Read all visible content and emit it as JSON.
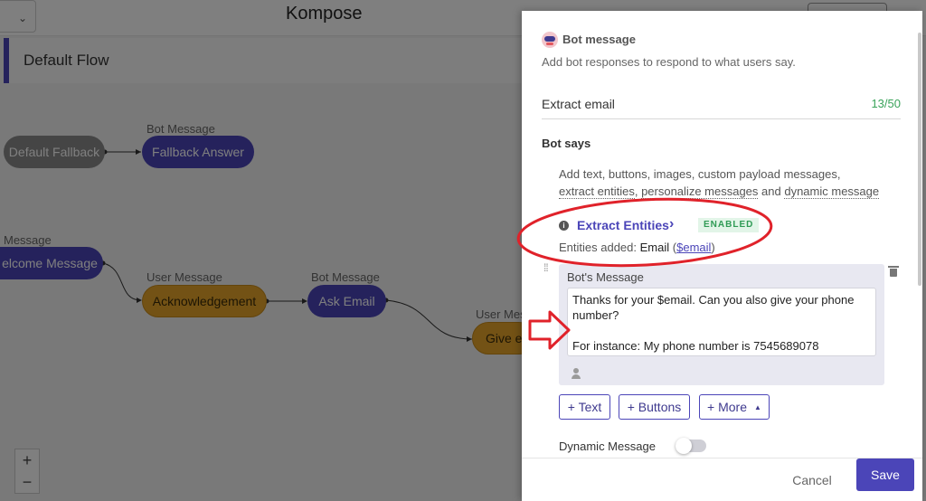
{
  "app": {
    "title": "Kompose"
  },
  "flow": {
    "title": "Default Flow"
  },
  "nodes": [
    {
      "id": "default-fallback",
      "type_label": "",
      "label": "Default Fallback",
      "kind": "grey"
    },
    {
      "id": "fallback-answer",
      "type_label": "Bot Message",
      "label": "Fallback Answer",
      "kind": "bot"
    },
    {
      "id": "welcome",
      "type_label": "Message",
      "label": "elcome Message",
      "kind": "bot"
    },
    {
      "id": "acknowledgement",
      "type_label": "User Message",
      "label": "Acknowledgement",
      "kind": "user"
    },
    {
      "id": "ask-email",
      "type_label": "Bot Message",
      "label": "Ask Email",
      "kind": "bot"
    },
    {
      "id": "give-email",
      "type_label": "User Mes",
      "label": "Give em",
      "kind": "user"
    }
  ],
  "zoom": {
    "in": "+",
    "out": "−"
  },
  "panel": {
    "title": "Bot message",
    "description": "Add bot responses to respond to what users say.",
    "name_value": "Extract email",
    "char_count": "13/50",
    "section_title": "Bot says",
    "help_line1": "Add text, buttons, images, custom payload messages,",
    "help_extract": "extract entities",
    "help_sep1": ", ",
    "help_personalize": "personalize messages",
    "help_and": " and ",
    "help_dynamic": "dynamic message",
    "extract_entities_label": "Extract Entities",
    "extract_chevron": "›",
    "enabled_badge": "ENABLED",
    "entities_prefix": "Entities added:",
    "entity_name": "Email",
    "entity_paren_open": "(",
    "entity_var": "$email",
    "entity_paren_close": ")",
    "card_title": "Bot's Message",
    "message_lines": [
      "Thanks for your $email. Can you also give your phone",
      "number?",
      "",
      "For instance: My phone number is 7545689078"
    ],
    "btn_text": "+ Text",
    "btn_buttons": "+ Buttons",
    "btn_more": "+ More",
    "dynamic_label": "Dynamic Message",
    "cancel": "Cancel",
    "save": "Save"
  },
  "colors": {
    "accent": "#4b45b8",
    "user_node": "#e6a52a",
    "annotation_red": "#e0222a",
    "count_green": "#3aa35a"
  }
}
